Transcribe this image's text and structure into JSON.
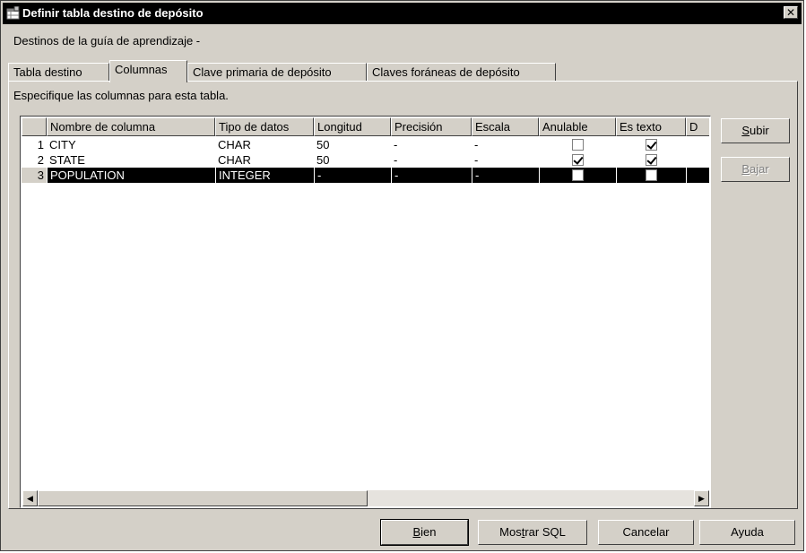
{
  "window": {
    "title": "Definir tabla destino de depósito",
    "close_glyph": "✕",
    "icon": "table-icon"
  },
  "subtitle": "Destinos de la guía de aprendizaje -",
  "tabs": [
    {
      "label": "Tabla destino",
      "active": false
    },
    {
      "label": "Columnas",
      "active": true
    },
    {
      "label": "Clave primaria de depósito",
      "active": false
    },
    {
      "label": "Claves foráneas de depósito",
      "active": false
    }
  ],
  "description": "Especifique las columnas para esta tabla.",
  "table": {
    "columns": [
      "",
      "Nombre de columna",
      "Tipo de datos",
      "Longitud",
      "Precisión",
      "Escala",
      "Anulable",
      "Es texto",
      "D"
    ],
    "rows": [
      {
        "num": "1",
        "name": "CITY",
        "type": "CHAR",
        "length": "50",
        "precision": "-",
        "scale": "-",
        "nullable": false,
        "is_text": true,
        "selected": false
      },
      {
        "num": "2",
        "name": "STATE",
        "type": "CHAR",
        "length": "50",
        "precision": "-",
        "scale": "-",
        "nullable": true,
        "is_text": true,
        "selected": false
      },
      {
        "num": "3",
        "name": "POPULATION",
        "type": "INTEGER",
        "length": "-",
        "precision": "-",
        "scale": "-",
        "nullable": false,
        "is_text": false,
        "selected": true
      }
    ]
  },
  "side_buttons": {
    "up": {
      "label": "Subir",
      "mnemonic": "S",
      "rest": "ubir"
    },
    "down": {
      "label": "Bajar",
      "mnemonic": "B",
      "rest": "ajar",
      "disabled": true
    }
  },
  "footer_buttons": {
    "ok": {
      "pre": "",
      "mnemonic": "B",
      "rest": "ien"
    },
    "sql": {
      "pre": "Mos",
      "mnemonic": "t",
      "rest": "rar SQL"
    },
    "cancel": "Cancelar",
    "help": "Ayuda"
  }
}
